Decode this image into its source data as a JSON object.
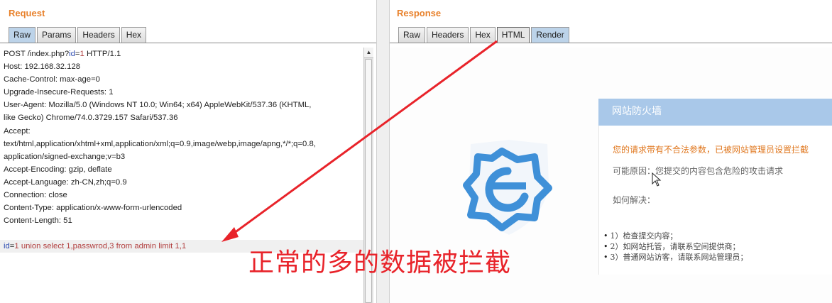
{
  "request": {
    "title": "Request",
    "tabs": [
      {
        "label": "Raw",
        "active": true
      },
      {
        "label": "Params",
        "active": false
      },
      {
        "label": "Headers",
        "active": false
      },
      {
        "label": "Hex",
        "active": false
      }
    ],
    "request_line": {
      "prefix": "POST /index.php?",
      "param_name": "id",
      "eq": "=",
      "param_value": "1",
      "suffix": " HTTP/1.1"
    },
    "headers": [
      "Host: 192.168.32.128",
      "Cache-Control: max-age=0",
      "Upgrade-Insecure-Requests: 1",
      "User-Agent: Mozilla/5.0 (Windows NT 10.0; Win64; x64) AppleWebKit/537.36 (KHTML,",
      "like Gecko) Chrome/74.0.3729.157 Safari/537.36",
      "Accept:",
      "text/html,application/xhtml+xml,application/xml;q=0.9,image/webp,image/apng,*/*;q=0.8,",
      "application/signed-exchange;v=b3",
      "Accept-Encoding: gzip, deflate",
      "Accept-Language: zh-CN,zh;q=0.9",
      "Connection: close",
      "Content-Type: application/x-www-form-urlencoded",
      "Content-Length: 51"
    ],
    "body": {
      "param_name": "id",
      "eq": "=",
      "param_value": "1 union select 1,passwrod,3 from admin limit 1,1"
    }
  },
  "response": {
    "title": "Response",
    "tabs": [
      {
        "label": "Raw",
        "active": false
      },
      {
        "label": "Headers",
        "active": false
      },
      {
        "label": "Hex",
        "active": false
      },
      {
        "label": "HTML",
        "active": false
      },
      {
        "label": "Render",
        "active": true
      }
    ],
    "waf": {
      "title": "网站防火墙",
      "warning": "您的请求带有不合法参数，已被网站管理员设置拦截",
      "reason": "可能原因：您提交的内容包含危险的攻击请求",
      "how": "如何解决：",
      "steps": [
        "1）检查提交内容；",
        "2）如网站托管，请联系空间提供商；",
        "3）普通网站访客，请联系网站管理员；"
      ]
    }
  },
  "annotation": "正常的多的数据被拦截",
  "colors": {
    "accent": "#e8812b",
    "annotation": "#e8232a",
    "shield": "#3f90d8",
    "waf_header": "#a9c8e9"
  },
  "icons": [
    "shield-e-icon",
    "mouse-cursor-icon",
    "scroll-up-arrow-icon"
  ]
}
